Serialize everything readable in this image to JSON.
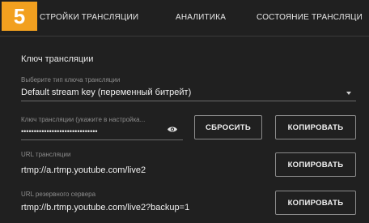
{
  "step_badge": "5",
  "tabs": [
    {
      "label": "СТРОЙКИ ТРАНСЛЯЦИИ"
    },
    {
      "label": "АНАЛИТИКА"
    },
    {
      "label": "СОСТОЯНИЕ ТРАНСЛЯЦИ"
    }
  ],
  "stream_key": {
    "section_title": "Ключ трансляции",
    "select_label": "Выберите тип ключа трансляции",
    "select_value": "Default stream key (переменный битрейт)",
    "key_label": "Ключ трансляции (укажите в настройка...",
    "key_value": "••••••••••••••••••••••••••••••",
    "reset_label": "СБРОСИТЬ",
    "copy_label": "КОПИРОВАТЬ"
  },
  "stream_url": {
    "label": "URL трансляции",
    "value": "rtmp://a.rtmp.youtube.com/live2",
    "copy_label": "КОПИРОВАТЬ"
  },
  "backup_url": {
    "label": "URL резервного сервера",
    "value": "rtmp://b.rtmp.youtube.com/live2?backup=1",
    "copy_label": "КОПИРОВАТЬ"
  },
  "icons": {
    "eye": "eye-icon",
    "dropdown": "chevron-down-icon"
  },
  "colors": {
    "badge": "#f2a01f",
    "background": "#202020"
  }
}
